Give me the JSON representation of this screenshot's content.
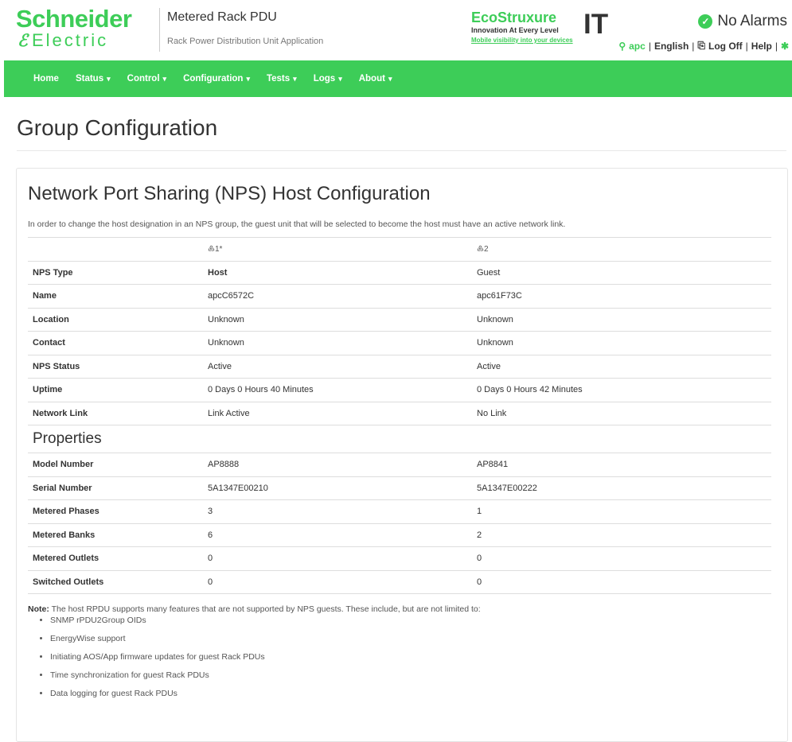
{
  "header": {
    "logo_line1": "Schneider",
    "logo_line2": "Electric",
    "app_title": "Metered Rack PDU",
    "app_subtitle": "Rack Power Distribution Unit Application",
    "eco_brand": "EcoStruxure",
    "eco_tagline": "Innovation At Every Level",
    "eco_link": "Mobile visibility into your devices",
    "eco_it": "IT",
    "alarm_status": "No Alarms",
    "user": "apc",
    "language": "English",
    "logoff": "Log Off",
    "help": "Help"
  },
  "nav": {
    "items": [
      {
        "label": "Home"
      },
      {
        "label": "Status"
      },
      {
        "label": "Control"
      },
      {
        "label": "Configuration"
      },
      {
        "label": "Tests"
      },
      {
        "label": "Logs"
      },
      {
        "label": "About"
      }
    ]
  },
  "page": {
    "title": "Group Configuration",
    "section_title": "Network Port Sharing (NPS) Host Configuration",
    "description": "In order to change the host designation in an NPS group, the guest unit that will be selected to become the host must have an active network link.",
    "columns": [
      "♸1*",
      "♸2"
    ],
    "rows": [
      {
        "label": "NPS Type",
        "c1": "Host",
        "c2": "Guest"
      },
      {
        "label": "Name",
        "c1": "apcC6572C",
        "c2": "apc61F73C"
      },
      {
        "label": "Location",
        "c1": "Unknown",
        "c2": "Unknown"
      },
      {
        "label": "Contact",
        "c1": "Unknown",
        "c2": "Unknown"
      },
      {
        "label": "NPS Status",
        "c1": "Active",
        "c2": "Active"
      },
      {
        "label": "Uptime",
        "c1": "0 Days 0 Hours 40 Minutes",
        "c2": "0 Days 0 Hours 42 Minutes"
      },
      {
        "label": "Network Link",
        "c1": "Link Active",
        "c2": "No Link"
      }
    ],
    "properties_title": "Properties",
    "prop_rows": [
      {
        "label": "Model Number",
        "c1": "AP8888",
        "c2": "AP8841"
      },
      {
        "label": "Serial Number",
        "c1": "5A1347E00210",
        "c2": "5A1347E00222"
      },
      {
        "label": "Metered Phases",
        "c1": "3",
        "c2": "1"
      },
      {
        "label": "Metered Banks",
        "c1": "6",
        "c2": "2"
      },
      {
        "label": "Metered Outlets",
        "c1": "0",
        "c2": "0"
      },
      {
        "label": "Switched Outlets",
        "c1": "0",
        "c2": "0"
      }
    ],
    "note_label": "Note:",
    "note_text": " The host RPDU supports many features that are not supported by NPS guests. These include, but are not limited to:",
    "note_items": [
      "SNMP rPDU2Group OIDs",
      "EnergyWise support",
      "Initiating AOS/App firmware updates for guest Rack PDUs",
      "Time synchronization for guest Rack PDUs",
      "Data logging for guest Rack PDUs"
    ]
  },
  "colors": {
    "brand_green": "#3dcd58",
    "text": "#333333"
  },
  "icons": [
    "check-circle-icon",
    "user-icon",
    "logoff-icon",
    "pin-icon",
    "caret-down-icon"
  ]
}
